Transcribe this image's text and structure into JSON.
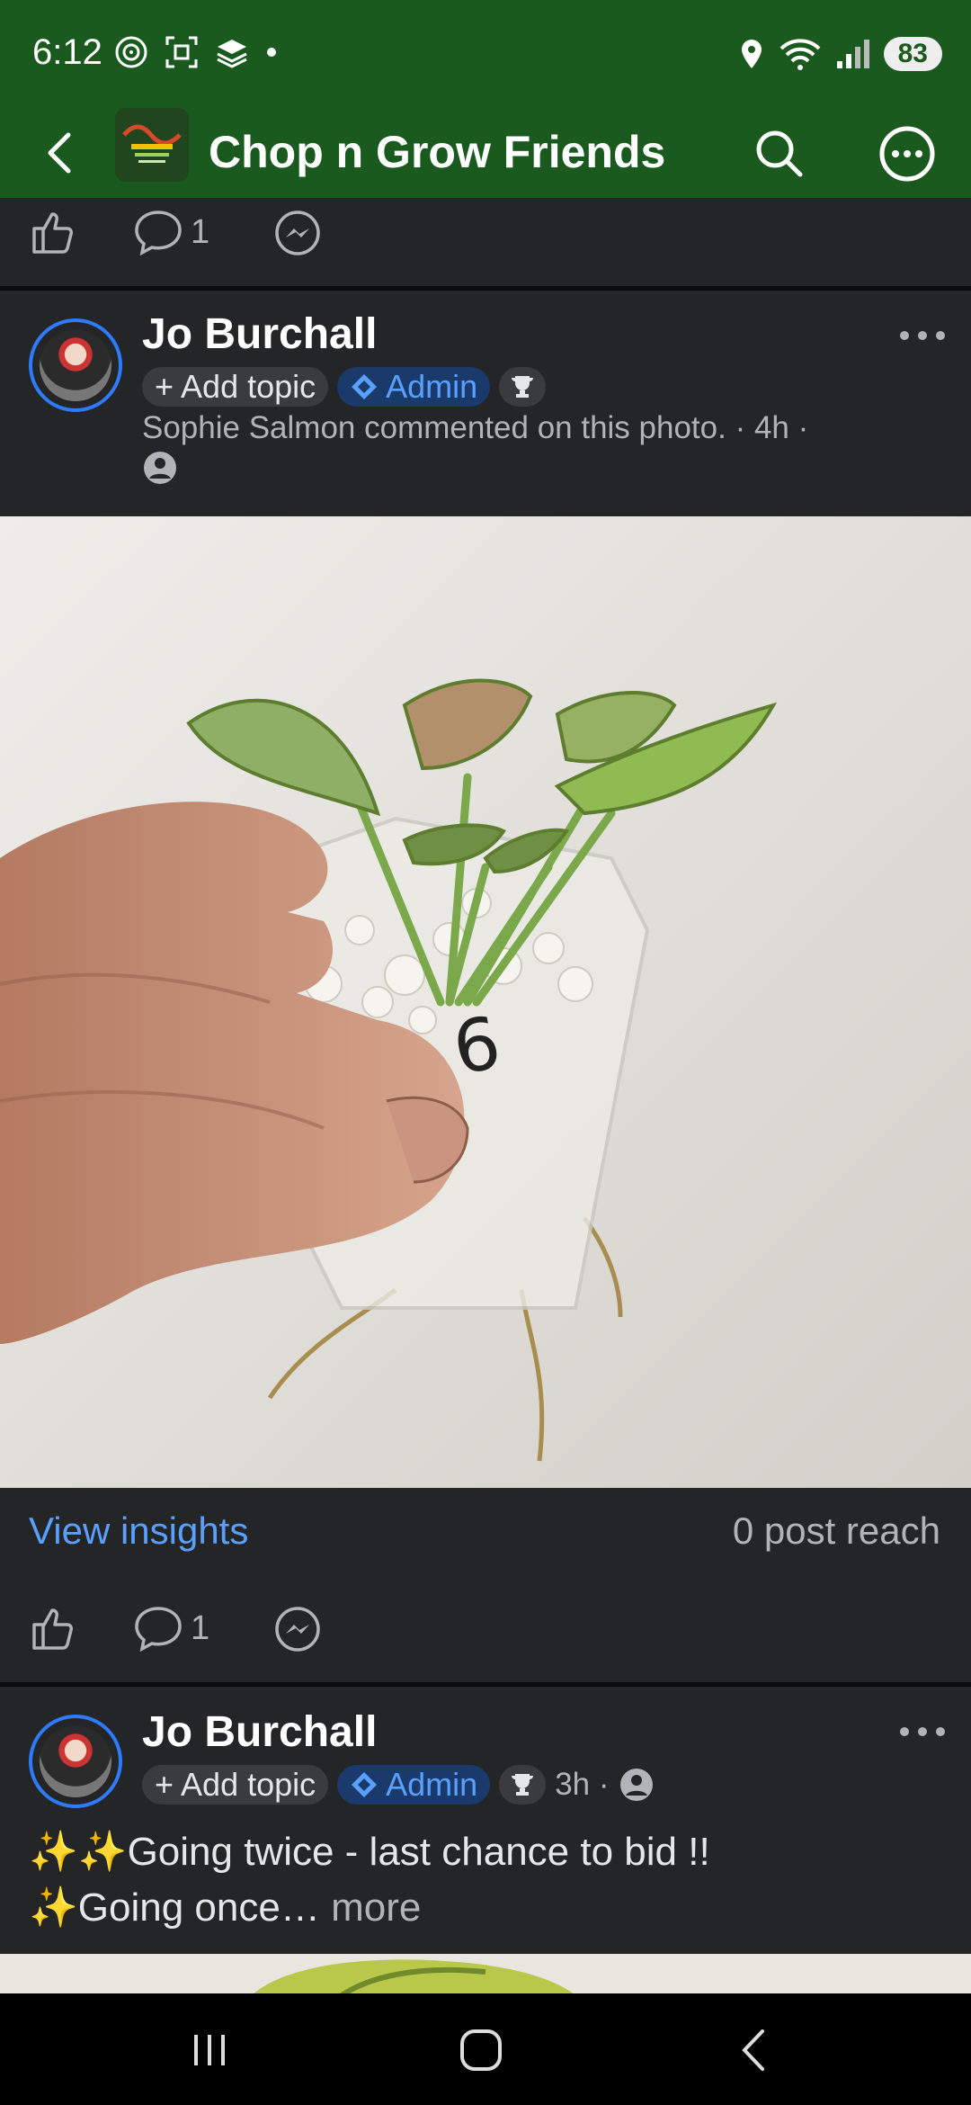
{
  "status": {
    "time": "6:12",
    "battery": "83"
  },
  "header": {
    "title": "Chop n Grow Friends"
  },
  "top_actions": {
    "comment_count": "1"
  },
  "post1": {
    "author": "Jo Burchall",
    "add_topic": "Add topic",
    "admin": "Admin",
    "activity": "Sophie Salmon commented on this photo. · 4h ·",
    "view_insights": "View insights",
    "post_reach": "0 post reach",
    "comment_count": "1"
  },
  "post2": {
    "author": "Jo Burchall",
    "add_topic": "Add topic",
    "admin": "Admin",
    "time": "3h ·",
    "text_line1": "✨✨Going twice - last chance to bid !!",
    "text_line2": "✨Going once…",
    "more": "more"
  },
  "colors": {
    "header": "#1a5a1f",
    "bg": "#242526",
    "link": "#5aa0ff",
    "admin_chip": "#1a3a6b"
  }
}
